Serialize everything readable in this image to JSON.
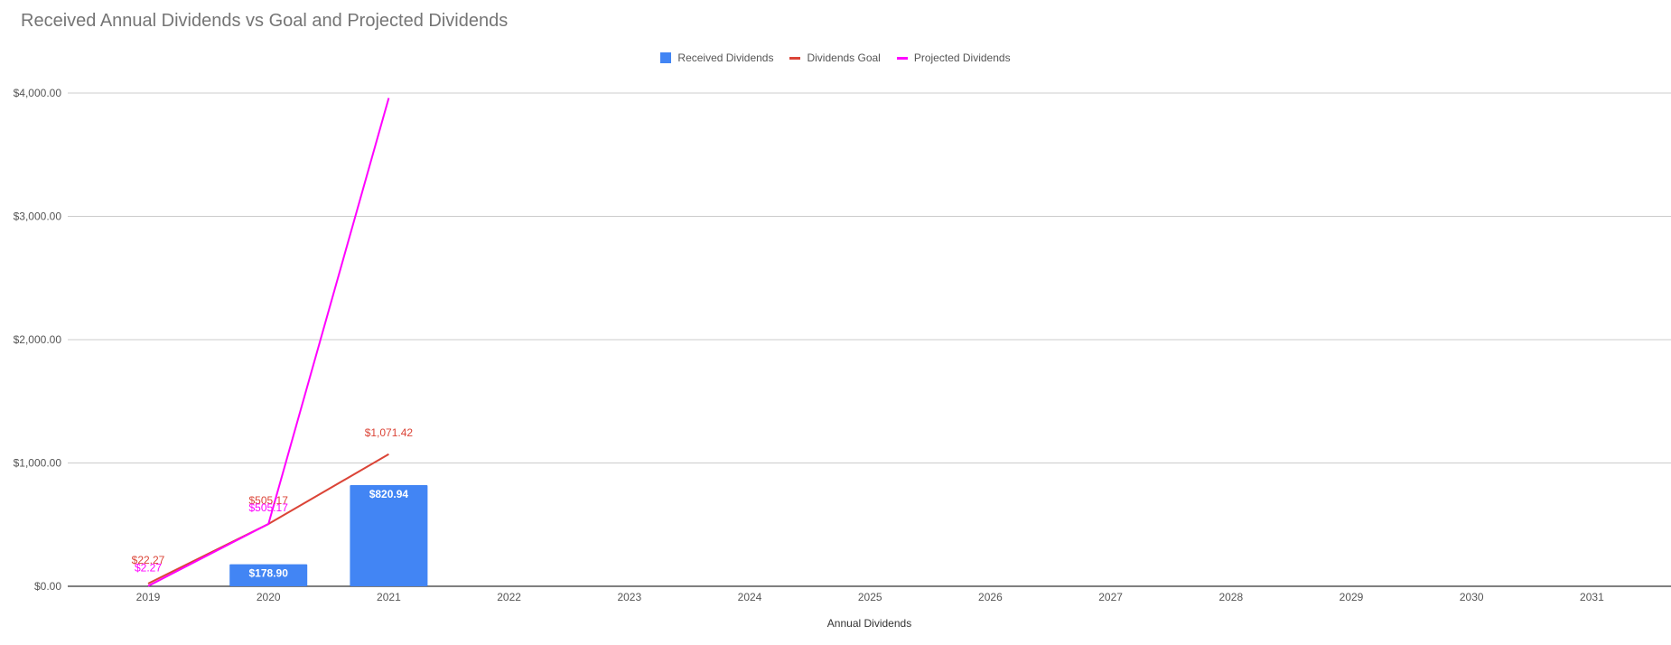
{
  "chart_data": {
    "type": "bar",
    "title": "Received Annual Dividends vs Goal and Projected Dividends",
    "xlabel": "Annual Dividends",
    "ylabel": "",
    "categories": [
      "2019",
      "2020",
      "2021",
      "2022",
      "2023",
      "2024",
      "2025",
      "2026",
      "2027",
      "2028",
      "2029",
      "2030",
      "2031"
    ],
    "ylim": [
      0,
      4000
    ],
    "y_ticks": [
      {
        "value": 0,
        "label": "$0.00"
      },
      {
        "value": 1000,
        "label": "$1,000.00"
      },
      {
        "value": 2000,
        "label": "$2,000.00"
      },
      {
        "value": 3000,
        "label": "$3,000.00"
      },
      {
        "value": 4000,
        "label": "$4,000.00"
      }
    ],
    "grid": true,
    "legend_position": "top-center",
    "series": [
      {
        "name": "Received Dividends",
        "kind": "bar",
        "color": "#4285f4",
        "values": [
          null,
          178.9,
          820.94
        ],
        "labels": [
          null,
          "$178.90",
          "$820.94"
        ]
      },
      {
        "name": "Dividends Goal",
        "kind": "line",
        "color": "#db4437",
        "values": [
          22.27,
          505.17,
          1071.42
        ],
        "labels": [
          "$22.27",
          "$505.17",
          "$1,071.42"
        ]
      },
      {
        "name": "Projected Dividends",
        "kind": "line",
        "color": "#ff00ff",
        "values": [
          2.27,
          505.17,
          3960
        ],
        "labels": [
          "$2.27",
          "$505.17",
          null
        ]
      }
    ]
  }
}
